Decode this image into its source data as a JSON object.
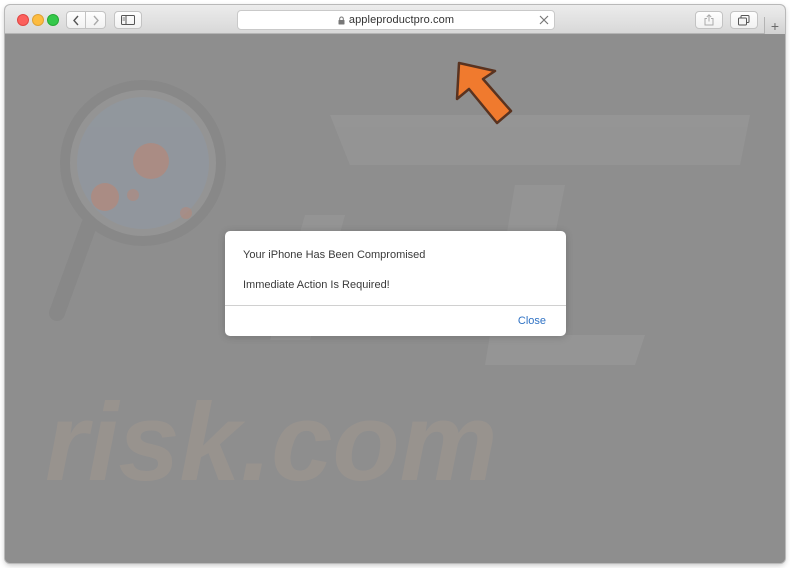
{
  "browser": {
    "url": "appleproductpro.com",
    "new_tab_label": "+"
  },
  "dialog": {
    "title": "Your iPhone Has Been Compromised",
    "message": "Immediate Action Is Required!",
    "close_label": "Close"
  },
  "watermark": {
    "text": "risk.com"
  },
  "colors": {
    "arrow": "#f07a2e",
    "link": "#2f72c4",
    "overlay": "#8e8e8e"
  }
}
